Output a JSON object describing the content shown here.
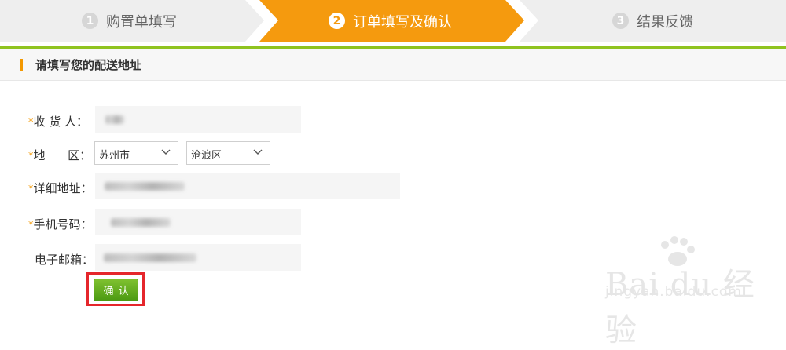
{
  "steps": [
    {
      "number": "1",
      "label": "购置单填写",
      "state": "inactive"
    },
    {
      "number": "2",
      "label": "订单填写及确认",
      "state": "active"
    },
    {
      "number": "3",
      "label": "结果反馈",
      "state": "inactive"
    }
  ],
  "colors": {
    "active_step": "#f59a0e",
    "inactive_step": "#eeeeee",
    "accent_green": "#8fc31f",
    "required_mark": "#f39800",
    "confirm_button": "#5fa91c",
    "highlight_box": "#e5262b"
  },
  "section": {
    "title": "请填写您的配送地址"
  },
  "form": {
    "required_mark": "*",
    "recipient_label": "收 货 人：",
    "region_label": "地      区：",
    "address_label": "详细地址：",
    "phone_label": "手机号码：",
    "email_label": "电子邮箱：",
    "city_value": "苏州市",
    "district_value": "沧浪区"
  },
  "actions": {
    "confirm_label": "确认"
  },
  "watermark": {
    "brand": "Bai du 经验",
    "url": "jingyan.baidu.com"
  }
}
